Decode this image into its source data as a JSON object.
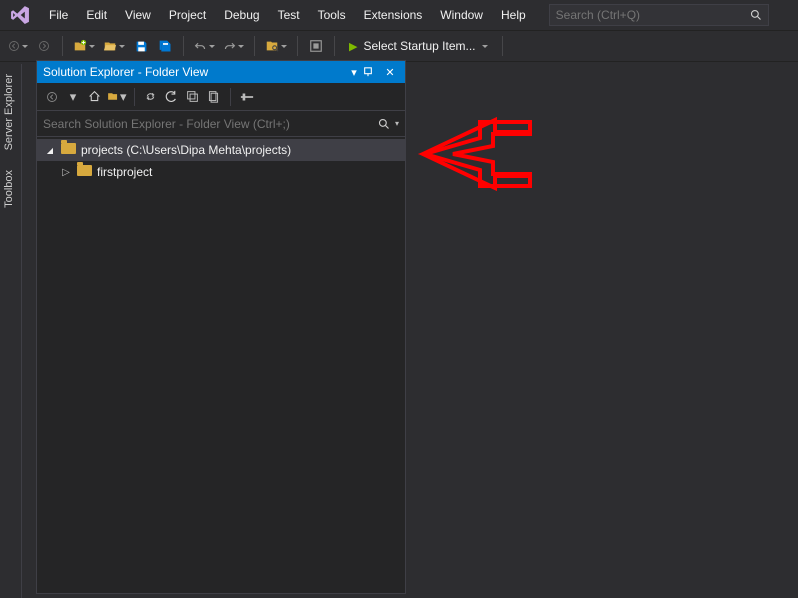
{
  "menubar": {
    "items": [
      "File",
      "Edit",
      "View",
      "Project",
      "Debug",
      "Test",
      "Tools",
      "Extensions",
      "Window",
      "Help"
    ],
    "search_placeholder": "Search (Ctrl+Q)"
  },
  "toolbar": {
    "start_label": "Select Startup Item..."
  },
  "side_tabs": [
    "Server Explorer",
    "Toolbox"
  ],
  "panel": {
    "title": "Solution Explorer - Folder View",
    "search_placeholder": "Search Solution Explorer - Folder View (Ctrl+;)",
    "tree": {
      "root": {
        "label": "projects (C:\\Users\\Dipa Mehta\\projects)"
      },
      "child1": {
        "label": "firstproject"
      }
    }
  }
}
